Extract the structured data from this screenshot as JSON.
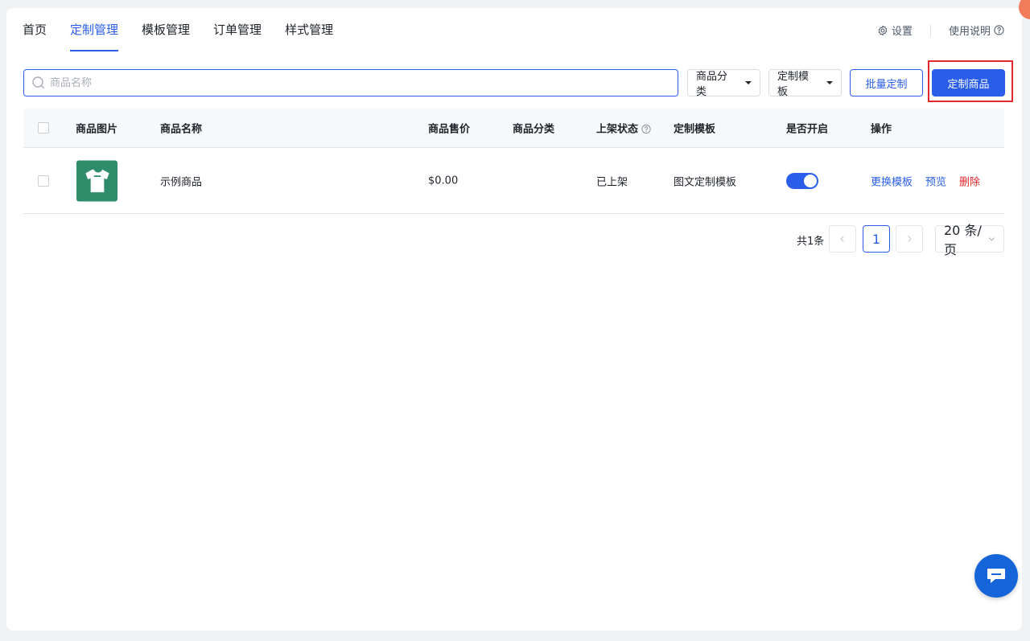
{
  "nav": {
    "tabs": [
      {
        "label": "首页",
        "active": false
      },
      {
        "label": "定制管理",
        "active": true
      },
      {
        "label": "模板管理",
        "active": false
      },
      {
        "label": "订单管理",
        "active": false
      },
      {
        "label": "样式管理",
        "active": false
      }
    ],
    "settings_label": "设置",
    "help_label": "使用说明"
  },
  "toolbar": {
    "search_placeholder": "商品名称",
    "category_select": "商品分类",
    "template_select": "定制模板",
    "batch_label": "批量定制",
    "customize_label": "定制商品"
  },
  "table": {
    "headers": {
      "image": "商品图片",
      "name": "商品名称",
      "price": "商品售价",
      "category": "商品分类",
      "status": "上架状态",
      "template": "定制模板",
      "enabled": "是否开启",
      "actions": "操作"
    },
    "rows": [
      {
        "name": "示例商品",
        "price": "$0.00",
        "category": "",
        "status": "已上架",
        "template": "图文定制模板",
        "enabled": true,
        "actions": [
          "更换模板",
          "预览",
          "删除"
        ]
      }
    ]
  },
  "pagination": {
    "total": "共1条",
    "current_page": "1",
    "page_size": "20 条/页"
  },
  "colors": {
    "primary": "#2a5ee8",
    "danger": "#e5262e",
    "highlight_box": "#e5262e"
  }
}
